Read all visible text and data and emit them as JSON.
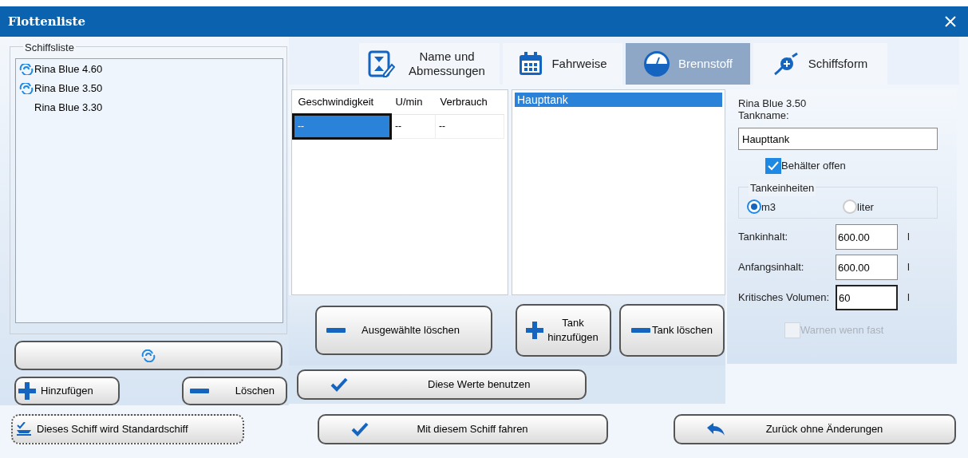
{
  "window": {
    "title": "Flottenliste"
  },
  "ship_list": {
    "title": "Schiffsliste",
    "items": [
      {
        "label": "Rina Blue 4.60",
        "linked": true
      },
      {
        "label": "Rina Blue 3.50",
        "linked": true
      },
      {
        "label": "Rina Blue 3.30",
        "linked": false
      }
    ]
  },
  "ship_buttons": [
    {
      "label": "Hinzufügen",
      "kind": "add"
    },
    {
      "label": "Löschen",
      "kind": "remove"
    }
  ],
  "tabs": [
    {
      "label": "Name und Abmessungen",
      "kind": "form",
      "selected": false
    },
    {
      "label": "Fahrweise",
      "kind": "calendar",
      "selected": false
    },
    {
      "label": "Brennstoff",
      "kind": "gauge",
      "selected": true
    },
    {
      "label": "Schiffsform",
      "kind": "hull",
      "selected": false
    }
  ],
  "table": {
    "columns": [
      "Geschwindigkeit",
      "U/min",
      "Verbrauch"
    ],
    "rows": [
      {
        "cells": [
          {
            "text": "--",
            "selected": true
          },
          {
            "text": "--",
            "selected": false
          },
          {
            "text": "--",
            "selected": false
          }
        ]
      }
    ]
  },
  "tank_list": [
    {
      "label": "Haupttank",
      "selected": true
    }
  ],
  "table_buttons": [
    {
      "label": "Ausgewählte löschen",
      "kind": "remove"
    }
  ],
  "tank_buttons": [
    {
      "label": "Tank hinzufügen",
      "kind": "add"
    },
    {
      "label": "Tank löschen",
      "kind": "remove"
    }
  ],
  "apply_button": {
    "label": "Diese Werte benutzen"
  },
  "tank_form": {
    "ship_name": "Rina Blue 3.50",
    "name_label": "Tankname:",
    "name_value": "Haupttank",
    "open_checkbox": {
      "label": "Behälter offen",
      "checked": true,
      "disabled": false
    },
    "units": {
      "title": "Tankeinheiten",
      "options": [
        {
          "label": "m3",
          "selected": true
        },
        {
          "label": "liter",
          "selected": false
        }
      ]
    },
    "fields": [
      {
        "label": "Tankinhalt:",
        "value": "600.00",
        "unit": "l"
      },
      {
        "label": "Anfangsinhalt:",
        "value": "600.00",
        "unit": "l"
      },
      {
        "label": "Kritisches Volumen:",
        "value": "60",
        "unit": "l"
      }
    ],
    "warn_checkbox": {
      "label": "Warnen wenn fast",
      "checked": false,
      "disabled": true
    }
  },
  "footer_buttons": [
    {
      "label": "Dieses Schiff wird Standardschiff",
      "kind": "ship"
    },
    {
      "label": "Mit diesem Schiff fahren",
      "kind": "check"
    },
    {
      "label": "Zurück ohne Änderungen",
      "kind": "back"
    }
  ]
}
